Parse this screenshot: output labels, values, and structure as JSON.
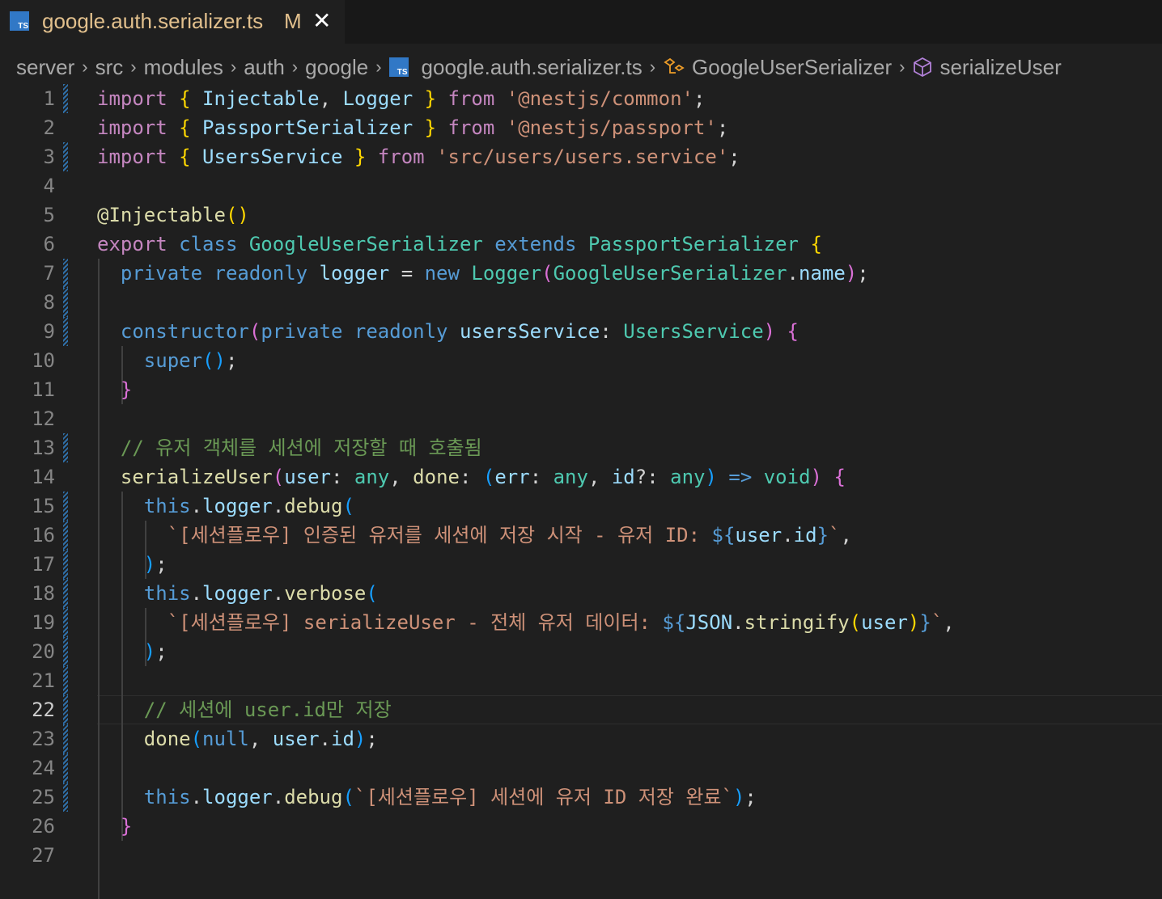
{
  "tab": {
    "icon_label": "TS",
    "title": "google.auth.serializer.ts",
    "modified": "M",
    "close": "✕"
  },
  "breadcrumb": {
    "segments": [
      "server",
      "src",
      "modules",
      "auth",
      "google",
      "google.auth.serializer.ts",
      "GoogleUserSerializer",
      "serializeUser"
    ],
    "separator": "›"
  },
  "editor": {
    "active_line": 22,
    "line_numbers": [
      "1",
      "2",
      "3",
      "4",
      "5",
      "6",
      "7",
      "8",
      "9",
      "10",
      "11",
      "12",
      "13",
      "14",
      "15",
      "16",
      "17",
      "18",
      "19",
      "20",
      "21",
      "22",
      "23",
      "24",
      "25",
      "26",
      "27"
    ],
    "modified_lines": [
      1,
      3,
      7,
      8,
      9,
      13,
      15,
      16,
      17,
      18,
      19,
      20,
      21,
      22,
      23,
      24,
      25
    ],
    "colors": {
      "keyword": "#c586c0",
      "storage": "#569cd6",
      "variable": "#9cdcfe",
      "type": "#4ec9b0",
      "function": "#dcdcaa",
      "string": "#ce9178",
      "comment": "#6a9955",
      "punct": "#d4d4d4",
      "bracket1": "#ffd700",
      "bracket2": "#da70d6",
      "bracket3": "#179fff"
    },
    "lines": [
      [
        [
          "import ",
          "keyword"
        ],
        [
          "{",
          "bracket1"
        ],
        [
          " Injectable",
          "variable"
        ],
        [
          ", ",
          "punct"
        ],
        [
          "Logger",
          "variable"
        ],
        [
          " ",
          "punct"
        ],
        [
          "}",
          "bracket1"
        ],
        [
          " from ",
          "keyword"
        ],
        [
          "'@nestjs/common'",
          "string"
        ],
        [
          ";",
          "punct"
        ]
      ],
      [
        [
          "import ",
          "keyword"
        ],
        [
          "{",
          "bracket1"
        ],
        [
          " PassportSerializer",
          "variable"
        ],
        [
          " ",
          "punct"
        ],
        [
          "}",
          "bracket1"
        ],
        [
          " from ",
          "keyword"
        ],
        [
          "'@nestjs/passport'",
          "string"
        ],
        [
          ";",
          "punct"
        ]
      ],
      [
        [
          "import ",
          "keyword"
        ],
        [
          "{",
          "bracket1"
        ],
        [
          " UsersService",
          "variable"
        ],
        [
          " ",
          "punct"
        ],
        [
          "}",
          "bracket1"
        ],
        [
          " from ",
          "keyword"
        ],
        [
          "'src/users/users.service'",
          "string"
        ],
        [
          ";",
          "punct"
        ]
      ],
      [],
      [
        [
          "@Injectable",
          "function"
        ],
        [
          "()",
          "bracket1"
        ]
      ],
      [
        [
          "export ",
          "keyword"
        ],
        [
          "class ",
          "storage"
        ],
        [
          "GoogleUserSerializer",
          "type"
        ],
        [
          " extends ",
          "storage"
        ],
        [
          "PassportSerializer",
          "type"
        ],
        [
          " ",
          "punct"
        ],
        [
          "{",
          "bracket1"
        ]
      ],
      [
        [
          "  ",
          "punct"
        ],
        [
          "private ",
          "storage"
        ],
        [
          "readonly ",
          "storage"
        ],
        [
          "logger",
          "variable"
        ],
        [
          " = ",
          "punct"
        ],
        [
          "new ",
          "storage"
        ],
        [
          "Logger",
          "type"
        ],
        [
          "(",
          "bracket2"
        ],
        [
          "GoogleUserSerializer",
          "type"
        ],
        [
          ".",
          "punct"
        ],
        [
          "name",
          "variable"
        ],
        [
          ")",
          "bracket2"
        ],
        [
          ";",
          "punct"
        ]
      ],
      [],
      [
        [
          "  ",
          "punct"
        ],
        [
          "constructor",
          "storage"
        ],
        [
          "(",
          "bracket2"
        ],
        [
          "private ",
          "storage"
        ],
        [
          "readonly ",
          "storage"
        ],
        [
          "usersService",
          "variable"
        ],
        [
          ": ",
          "punct"
        ],
        [
          "UsersService",
          "type"
        ],
        [
          ")",
          "bracket2"
        ],
        [
          " ",
          "punct"
        ],
        [
          "{",
          "bracket2"
        ]
      ],
      [
        [
          "    ",
          "punct"
        ],
        [
          "super",
          "storage"
        ],
        [
          "()",
          "bracket3"
        ],
        [
          ";",
          "punct"
        ]
      ],
      [
        [
          "  ",
          "punct"
        ],
        [
          "}",
          "bracket2"
        ]
      ],
      [],
      [
        [
          "  ",
          "punct"
        ],
        [
          "// 유저 객체를 세션에 저장할 때 호출됨",
          "comment"
        ]
      ],
      [
        [
          "  ",
          "punct"
        ],
        [
          "serializeUser",
          "function"
        ],
        [
          "(",
          "bracket2"
        ],
        [
          "user",
          "variable"
        ],
        [
          ": ",
          "punct"
        ],
        [
          "any",
          "type"
        ],
        [
          ", ",
          "punct"
        ],
        [
          "done",
          "function"
        ],
        [
          ": ",
          "punct"
        ],
        [
          "(",
          "bracket3"
        ],
        [
          "err",
          "variable"
        ],
        [
          ": ",
          "punct"
        ],
        [
          "any",
          "type"
        ],
        [
          ", ",
          "punct"
        ],
        [
          "id",
          "variable"
        ],
        [
          "?: ",
          "punct"
        ],
        [
          "any",
          "type"
        ],
        [
          ")",
          "bracket3"
        ],
        [
          " => ",
          "storage"
        ],
        [
          "void",
          "type"
        ],
        [
          ")",
          "bracket2"
        ],
        [
          " ",
          "punct"
        ],
        [
          "{",
          "bracket2"
        ]
      ],
      [
        [
          "    ",
          "punct"
        ],
        [
          "this",
          "storage"
        ],
        [
          ".",
          "punct"
        ],
        [
          "logger",
          "variable"
        ],
        [
          ".",
          "punct"
        ],
        [
          "debug",
          "function"
        ],
        [
          "(",
          "bracket3"
        ]
      ],
      [
        [
          "      ",
          "punct"
        ],
        [
          "`[세션플로우] 인증된 유저를 세션에 저장 시작 - 유저 ID: ",
          "string"
        ],
        [
          "${",
          "storage"
        ],
        [
          "user",
          "variable"
        ],
        [
          ".",
          "punct"
        ],
        [
          "id",
          "variable"
        ],
        [
          "}",
          "storage"
        ],
        [
          "`",
          "string"
        ],
        [
          ",",
          "punct"
        ]
      ],
      [
        [
          "    ",
          "punct"
        ],
        [
          ")",
          "bracket3"
        ],
        [
          ";",
          "punct"
        ]
      ],
      [
        [
          "    ",
          "punct"
        ],
        [
          "this",
          "storage"
        ],
        [
          ".",
          "punct"
        ],
        [
          "logger",
          "variable"
        ],
        [
          ".",
          "punct"
        ],
        [
          "verbose",
          "function"
        ],
        [
          "(",
          "bracket3"
        ]
      ],
      [
        [
          "      ",
          "punct"
        ],
        [
          "`[세션플로우] serializeUser - 전체 유저 데이터: ",
          "string"
        ],
        [
          "${",
          "storage"
        ],
        [
          "JSON",
          "variable"
        ],
        [
          ".",
          "punct"
        ],
        [
          "stringify",
          "function"
        ],
        [
          "(",
          "bracket1"
        ],
        [
          "user",
          "variable"
        ],
        [
          ")",
          "bracket1"
        ],
        [
          "}",
          "storage"
        ],
        [
          "`",
          "string"
        ],
        [
          ",",
          "punct"
        ]
      ],
      [
        [
          "    ",
          "punct"
        ],
        [
          ")",
          "bracket3"
        ],
        [
          ";",
          "punct"
        ]
      ],
      [],
      [
        [
          "    ",
          "punct"
        ],
        [
          "// 세션에 user.id만 저장",
          "comment"
        ]
      ],
      [
        [
          "    ",
          "punct"
        ],
        [
          "done",
          "function"
        ],
        [
          "(",
          "bracket3"
        ],
        [
          "null",
          "storage"
        ],
        [
          ", ",
          "punct"
        ],
        [
          "user",
          "variable"
        ],
        [
          ".",
          "punct"
        ],
        [
          "id",
          "variable"
        ],
        [
          ")",
          "bracket3"
        ],
        [
          ";",
          "punct"
        ]
      ],
      [],
      [
        [
          "    ",
          "punct"
        ],
        [
          "this",
          "storage"
        ],
        [
          ".",
          "punct"
        ],
        [
          "logger",
          "variable"
        ],
        [
          ".",
          "punct"
        ],
        [
          "debug",
          "function"
        ],
        [
          "(",
          "bracket3"
        ],
        [
          "`[세션플로우] 세션에 유저 ID 저장 완료`",
          "string"
        ],
        [
          ")",
          "bracket3"
        ],
        [
          ";",
          "punct"
        ]
      ],
      [
        [
          "  ",
          "punct"
        ],
        [
          "}",
          "bracket2"
        ]
      ],
      []
    ]
  }
}
